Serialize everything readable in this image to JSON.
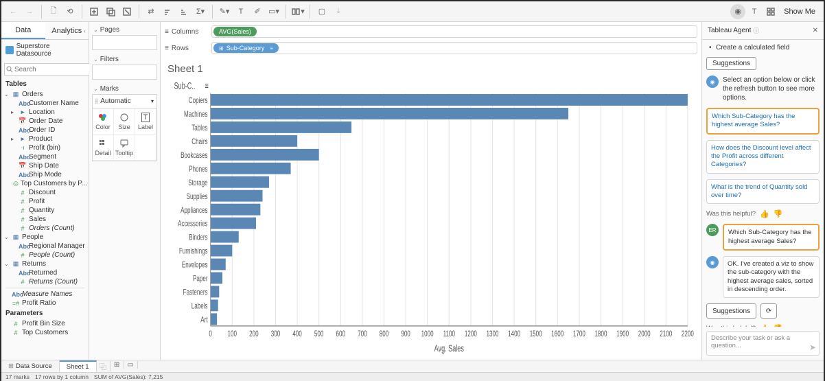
{
  "toolbar": {
    "showme": "Show Me"
  },
  "datapanel": {
    "tabs": [
      "Data",
      "Analytics"
    ],
    "datasource": "Superstore Datasource",
    "search_placeholder": "Search",
    "tables_label": "Tables",
    "parameters_label": "Parameters",
    "groups": {
      "orders": {
        "label": "Orders",
        "fields": [
          {
            "icon": "Abc",
            "type": "str",
            "label": "Customer Name"
          },
          {
            "icon": "▸",
            "type": "geo",
            "label": "Location",
            "expand": true
          },
          {
            "icon": "📅",
            "type": "date",
            "label": "Order Date"
          },
          {
            "icon": "Abc",
            "type": "str",
            "label": "Order ID"
          },
          {
            "icon": "▸",
            "type": "str",
            "label": "Product",
            "expand": true
          },
          {
            "icon": "⋅ı",
            "type": "meas",
            "label": "Profit (bin)"
          },
          {
            "icon": "Abc",
            "type": "str",
            "label": "Segment"
          },
          {
            "icon": "📅",
            "type": "date",
            "label": "Ship Date"
          },
          {
            "icon": "Abc",
            "type": "str",
            "label": "Ship Mode"
          },
          {
            "icon": "◎",
            "type": "meas",
            "label": "Top Customers by P..."
          },
          {
            "icon": "#",
            "type": "num",
            "label": "Discount"
          },
          {
            "icon": "#",
            "type": "num",
            "label": "Profit"
          },
          {
            "icon": "#",
            "type": "num",
            "label": "Quantity"
          },
          {
            "icon": "#",
            "type": "num",
            "label": "Sales"
          },
          {
            "icon": "#",
            "type": "num",
            "label": "Orders (Count)",
            "italic": true
          }
        ]
      },
      "people": {
        "label": "People",
        "fields": [
          {
            "icon": "Abc",
            "type": "str",
            "label": "Regional Manager"
          },
          {
            "icon": "#",
            "type": "num",
            "label": "People (Count)",
            "italic": true
          }
        ]
      },
      "returns": {
        "label": "Returns",
        "fields": [
          {
            "icon": "Abc",
            "type": "str",
            "label": "Returned"
          },
          {
            "icon": "#",
            "type": "num",
            "label": "Returns (Count)",
            "italic": true
          }
        ]
      },
      "extra": [
        {
          "icon": "Abc",
          "type": "str",
          "label": "Measure Names",
          "italic": true
        },
        {
          "icon": "=#",
          "type": "num",
          "label": "Profit Ratio"
        }
      ],
      "parameters": [
        {
          "icon": "#",
          "type": "num",
          "label": "Profit Bin Size"
        },
        {
          "icon": "#",
          "type": "num",
          "label": "Top Customers"
        }
      ]
    }
  },
  "shelves": {
    "pages": "Pages",
    "filters": "Filters",
    "marks": "Marks",
    "marks_type": "Automatic",
    "marks_cells": [
      "Color",
      "Size",
      "Label",
      "Detail",
      "Tooltip"
    ]
  },
  "colrow": {
    "columns_label": "Columns",
    "rows_label": "Rows",
    "columns_pill": "AVG(Sales)",
    "rows_pill": "Sub-Category"
  },
  "sheet": {
    "title": "Sheet 1",
    "y_header": "Sub-C..",
    "x_title": "Avg. Sales"
  },
  "chart_data": {
    "type": "bar",
    "orientation": "horizontal",
    "categories": [
      "Copiers",
      "Machines",
      "Tables",
      "Chairs",
      "Bookcases",
      "Phones",
      "Storage",
      "Supplies",
      "Appliances",
      "Accessories",
      "Binders",
      "Furnishings",
      "Envelopes",
      "Paper",
      "Fasteners",
      "Labels",
      "Art"
    ],
    "values": [
      2200,
      1650,
      650,
      400,
      500,
      370,
      270,
      240,
      230,
      210,
      130,
      100,
      70,
      55,
      40,
      35,
      30
    ],
    "xlabel": "Avg. Sales",
    "ylabel": "Sub-Category",
    "xlim": [
      0,
      2200
    ],
    "x_ticks": [
      0,
      100,
      200,
      300,
      400,
      500,
      600,
      700,
      800,
      900,
      1000,
      1100,
      1200,
      1300,
      1400,
      1500,
      1600,
      1700,
      1800,
      1900,
      2000,
      2100,
      2200
    ]
  },
  "agent": {
    "title": "Tableau Agent",
    "bullet": "Create a calculated field",
    "suggestions_btn": "Suggestions",
    "intro": "Select an option below or click the refresh button to see more options.",
    "cards": [
      "Which Sub-Category has the highest average Sales?",
      "How does the Discount level affect the Profit across different Categories?",
      "What is the trend of Quantity sold over time?"
    ],
    "helpful": "Was this helpful?",
    "user_msg": "Which Sub-Category has the highest average Sales?",
    "bot_reply": "OK. I've created a viz to show the sub-category with the highest average sales, sorted in descending order.",
    "input_placeholder": "Describe your task or ask a question..."
  },
  "bottom": {
    "datasource_tab": "Data Source",
    "sheet_tab": "Sheet 1"
  },
  "status": {
    "marks": "17 marks",
    "rows": "17 rows by 1 column",
    "sum": "SUM of AVG(Sales): 7,215"
  }
}
